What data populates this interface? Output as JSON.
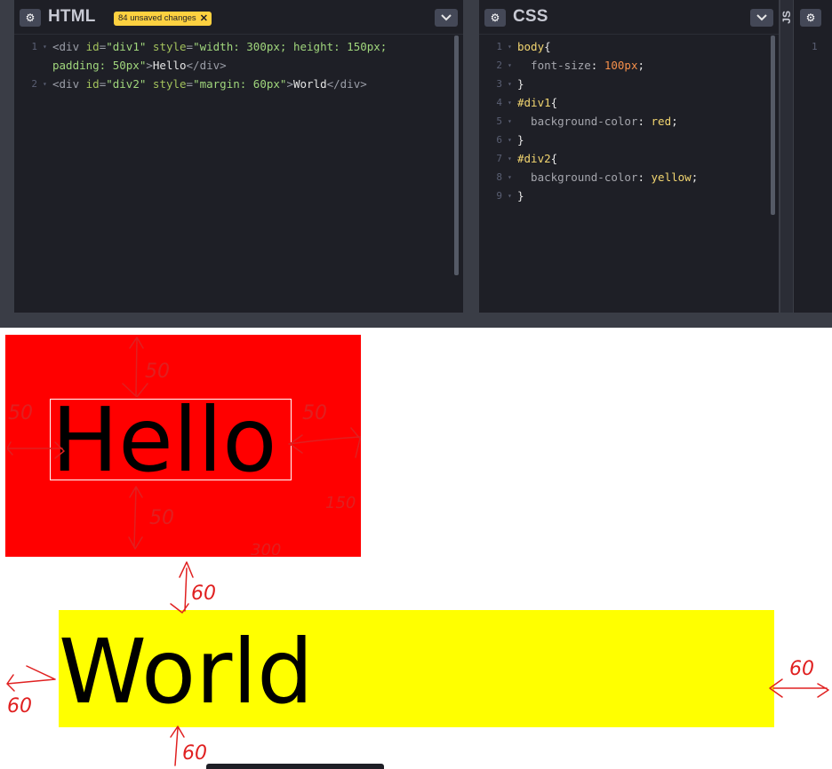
{
  "html_panel": {
    "title": "HTML",
    "badge": "84 unsaved changes",
    "badge_close": "✕",
    "lines": [
      {
        "no": "1",
        "segments": [
          {
            "t": "<div ",
            "c": "t-tag"
          },
          {
            "t": "id",
            "c": "t-attr"
          },
          {
            "t": "=",
            "c": "t-tag"
          },
          {
            "t": "\"div1\"",
            "c": "t-str"
          },
          {
            "t": " style",
            "c": "t-attr"
          },
          {
            "t": "=",
            "c": "t-tag"
          },
          {
            "t": "\"width: 300px; height: 150px;",
            "c": "t-str"
          }
        ]
      },
      {
        "no": "",
        "segments": [
          {
            "t": "padding: 50px\"",
            "c": "t-str"
          },
          {
            "t": ">",
            "c": "t-tag"
          },
          {
            "t": "Hello",
            "c": "t-text"
          },
          {
            "t": "</div>",
            "c": "t-tag"
          }
        ]
      },
      {
        "no": "2",
        "segments": [
          {
            "t": "<div ",
            "c": "t-tag"
          },
          {
            "t": "id",
            "c": "t-attr"
          },
          {
            "t": "=",
            "c": "t-tag"
          },
          {
            "t": "\"div2\"",
            "c": "t-str"
          },
          {
            "t": " style",
            "c": "t-attr"
          },
          {
            "t": "=",
            "c": "t-tag"
          },
          {
            "t": "\"margin: 60px\"",
            "c": "t-str"
          },
          {
            "t": ">",
            "c": "t-tag"
          },
          {
            "t": "World",
            "c": "t-text"
          },
          {
            "t": "</div>",
            "c": "t-tag"
          }
        ]
      }
    ]
  },
  "css_panel": {
    "title": "CSS",
    "lines": [
      {
        "no": "1",
        "segments": [
          {
            "t": "body",
            "c": "t-sel"
          },
          {
            "t": "{",
            "c": "t-br"
          }
        ]
      },
      {
        "no": "2",
        "segments": [
          {
            "t": "  font-size",
            "c": "t-prop"
          },
          {
            "t": ": ",
            "c": "t-br"
          },
          {
            "t": "100px",
            "c": "t-val-num"
          },
          {
            "t": ";",
            "c": "t-br"
          }
        ]
      },
      {
        "no": "3",
        "segments": [
          {
            "t": "}",
            "c": "t-br"
          }
        ]
      },
      {
        "no": "4",
        "segments": [
          {
            "t": "#div1",
            "c": "t-sel"
          },
          {
            "t": "{",
            "c": "t-br"
          }
        ]
      },
      {
        "no": "5",
        "segments": [
          {
            "t": "  background-color",
            "c": "t-prop"
          },
          {
            "t": ": ",
            "c": "t-br"
          },
          {
            "t": "red",
            "c": "t-val-red"
          },
          {
            "t": ";",
            "c": "t-br"
          }
        ]
      },
      {
        "no": "6",
        "segments": [
          {
            "t": "}",
            "c": "t-br"
          }
        ]
      },
      {
        "no": "7",
        "segments": [
          {
            "t": "#div2",
            "c": "t-sel"
          },
          {
            "t": "{",
            "c": "t-br"
          }
        ]
      },
      {
        "no": "8",
        "segments": [
          {
            "t": "  background-color",
            "c": "t-prop"
          },
          {
            "t": ": ",
            "c": "t-br"
          },
          {
            "t": "yellow",
            "c": "t-val-red"
          },
          {
            "t": ";",
            "c": "t-br"
          }
        ]
      },
      {
        "no": "9",
        "segments": [
          {
            "t": "}",
            "c": "t-br"
          }
        ]
      }
    ]
  },
  "js_panel": {
    "title": "JS",
    "line_no": "1"
  },
  "preview": {
    "hello": "Hello",
    "world": "World",
    "annotations": {
      "top_50": "50",
      "left_50": "50",
      "right_50": "50",
      "bottom_50": "50",
      "height_150": "150",
      "width_300": "300",
      "div2_top_60": "60",
      "div2_left_60": "60",
      "div2_right_60": "60",
      "div2_bottom_60": "60"
    }
  },
  "colors": {
    "editor_bg": "#1e1f26",
    "badge": "#fdd140",
    "div1_bg": "#ff0000",
    "div2_bg": "#ffff00",
    "annotation": "#e02020"
  }
}
